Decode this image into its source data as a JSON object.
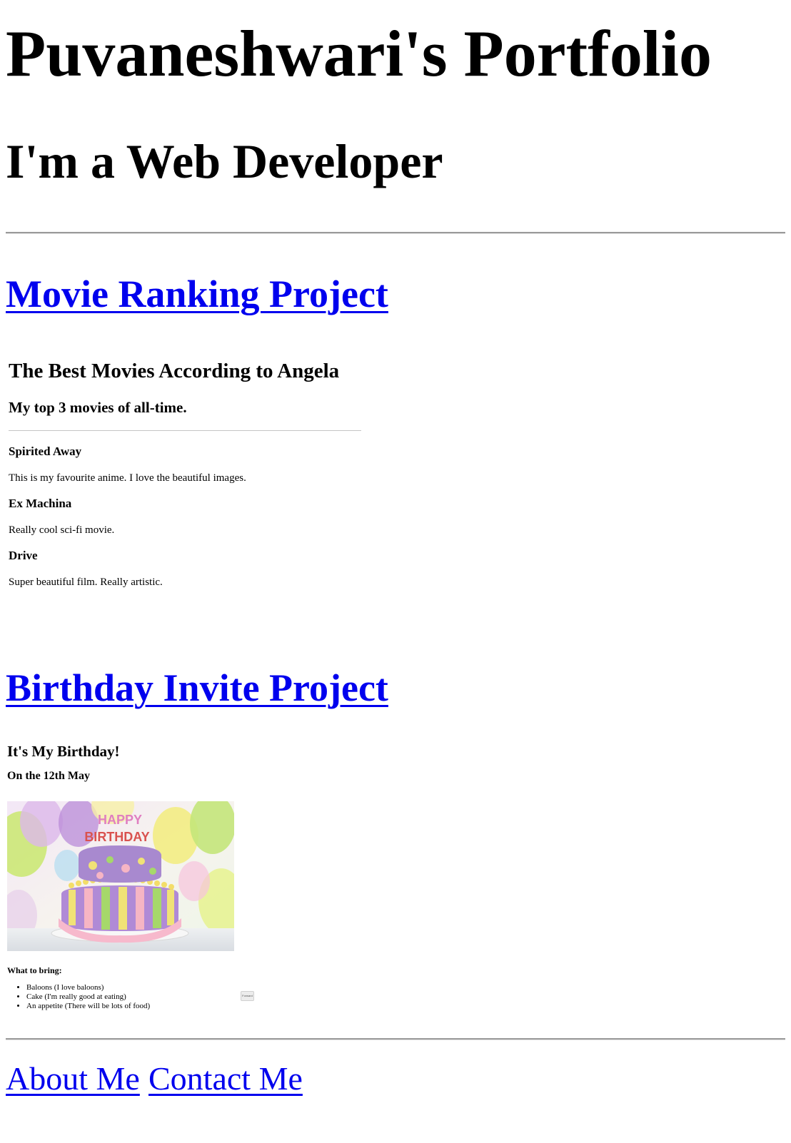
{
  "header": {
    "title": "Puvaneshwari's Portfolio",
    "subtitle": "I'm a Web Developer"
  },
  "projects": {
    "movie": {
      "link_label": "Movie Ranking Project",
      "heading": "The Best Movies According to Angela",
      "subheading": "My top 3 movies of all-time.",
      "movies": [
        {
          "name": "Spirited Away",
          "description": "This is my favourite anime. I love the beautiful images."
        },
        {
          "name": "Ex Machina",
          "description": "Really cool sci-fi movie."
        },
        {
          "name": "Drive",
          "description": "Super beautiful film. Really artistic."
        }
      ]
    },
    "birthday": {
      "link_label": "Birthday Invite Project",
      "heading": "It's My Birthday!",
      "date": "On the 12th May",
      "cake_text_top": "HAPPY",
      "cake_text_bottom": "BIRTHDAY",
      "bring_label": "What to bring:",
      "bring_items": [
        "Baloons (I love baloons)",
        "Cake (I'm really good at eating)",
        "An appetite (There will be lots of food)"
      ],
      "button_label": "Forward"
    }
  },
  "footer": {
    "about_label": "About Me",
    "contact_label": "Contact Me"
  },
  "colors": {
    "link": "#0000ee",
    "text": "#000000",
    "background": "#ffffff"
  }
}
